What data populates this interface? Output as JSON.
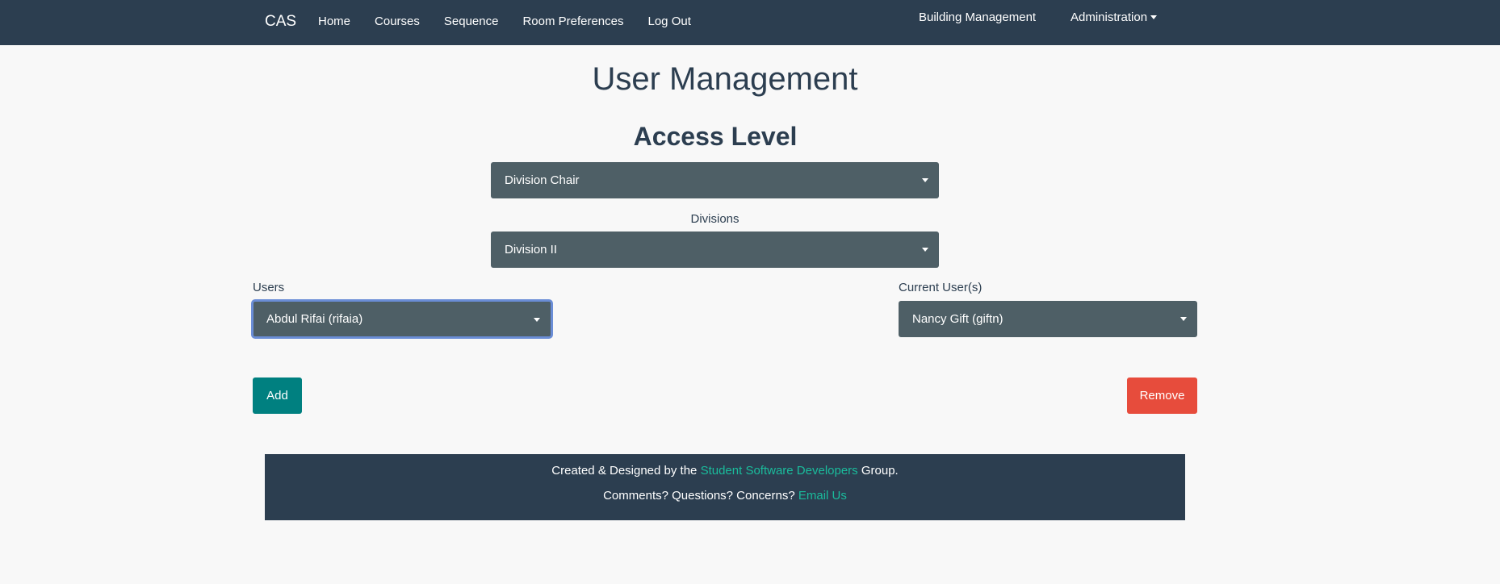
{
  "navbar": {
    "brand": "CAS",
    "links": [
      "Home",
      "Courses",
      "Sequence",
      "Room Preferences",
      "Log Out"
    ],
    "right_links": {
      "building": "Building Management",
      "administration": "Administration"
    }
  },
  "page": {
    "title": "User Management",
    "access_level_heading": "Access Level"
  },
  "access_level": {
    "selected": "Division Chair"
  },
  "divisions": {
    "label": "Divisions",
    "selected": "Division II"
  },
  "users": {
    "label": "Users",
    "selected": "Abdul Rifai (rifaia)"
  },
  "current_users": {
    "label": "Current User(s)",
    "selected": "Nancy Gift (giftn)"
  },
  "buttons": {
    "add": "Add",
    "remove": "Remove"
  },
  "footer": {
    "line1_prefix": "Created & Designed by the ",
    "line1_link": "Student Software Developers",
    "line1_suffix": " Group.",
    "line2_prefix": "Comments? Questions? Concerns? ",
    "line2_link": "Email Us"
  },
  "colors": {
    "navbar": "#2c3e50",
    "select_bg": "#4e5f66",
    "add_button": "#008080",
    "remove_button": "#e74c3c",
    "link_accent": "#1abc9c"
  }
}
